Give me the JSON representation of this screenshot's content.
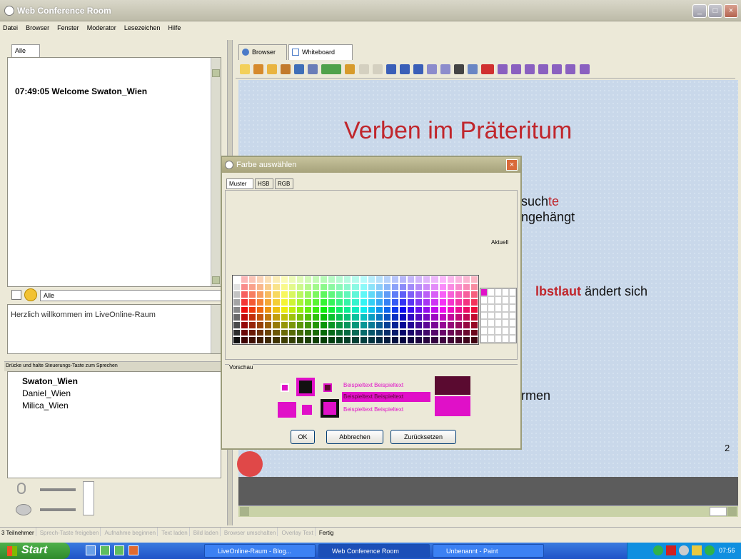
{
  "window": {
    "title": "Web Conference Room"
  },
  "menu": [
    "Datei",
    "Browser",
    "Fenster",
    "Moderator",
    "Lesezeichen",
    "Hilfe"
  ],
  "chat": {
    "tab": "Alle",
    "message": "07:49:05 Welcome Swaton_Wien",
    "recipient": "Alle",
    "input_text": "Herzlich willkommen im LiveOnline-Raum"
  },
  "participants": {
    "header": "Drücke und halte Steuerungs-Taste zum Sprechen",
    "names": [
      "Swaton_Wien",
      "Daniel_Wien",
      "Milica_Wien"
    ]
  },
  "main_tabs": [
    "Browser",
    "Whiteboard"
  ],
  "slide": {
    "title": "Verben im Präteritum",
    "fragment_1a": "such",
    "fragment_1b": "te",
    "fragment_2": "ngehängt",
    "fragment_3a": "lbstlaut",
    "fragment_3b": " ändert sich",
    "fragment_4": "rmen",
    "page_number": "2"
  },
  "dialog": {
    "title": "Farbe auswählen",
    "tabs": [
      "Muster",
      "HSB",
      "RGB"
    ],
    "recent_label": "Aktuell",
    "preview_label": "Vorschau",
    "sample_text": "Beispieltext",
    "buttons": {
      "ok": "OK",
      "cancel": "Abbrechen",
      "reset": "Zurücksetzen"
    },
    "selected_color": "#e010c8",
    "dark_color": "#5a0a30"
  },
  "statusbar": [
    "3 Teilnehmer",
    "Sprech-Taste freigeben",
    "Aufnahme beginnen",
    "Text laden",
    "Bild laden",
    "Browser umschalten",
    "Overlay Text",
    "Fertig"
  ],
  "taskbar": {
    "start": "Start",
    "tasks": [
      "LiveOnline-Raum - Blog...",
      "Web Conference Room",
      "Unbenannt - Paint"
    ],
    "clock": "07:56"
  },
  "colors": {
    "accent": "#c0262c",
    "titlebar": "#bdbba8"
  }
}
